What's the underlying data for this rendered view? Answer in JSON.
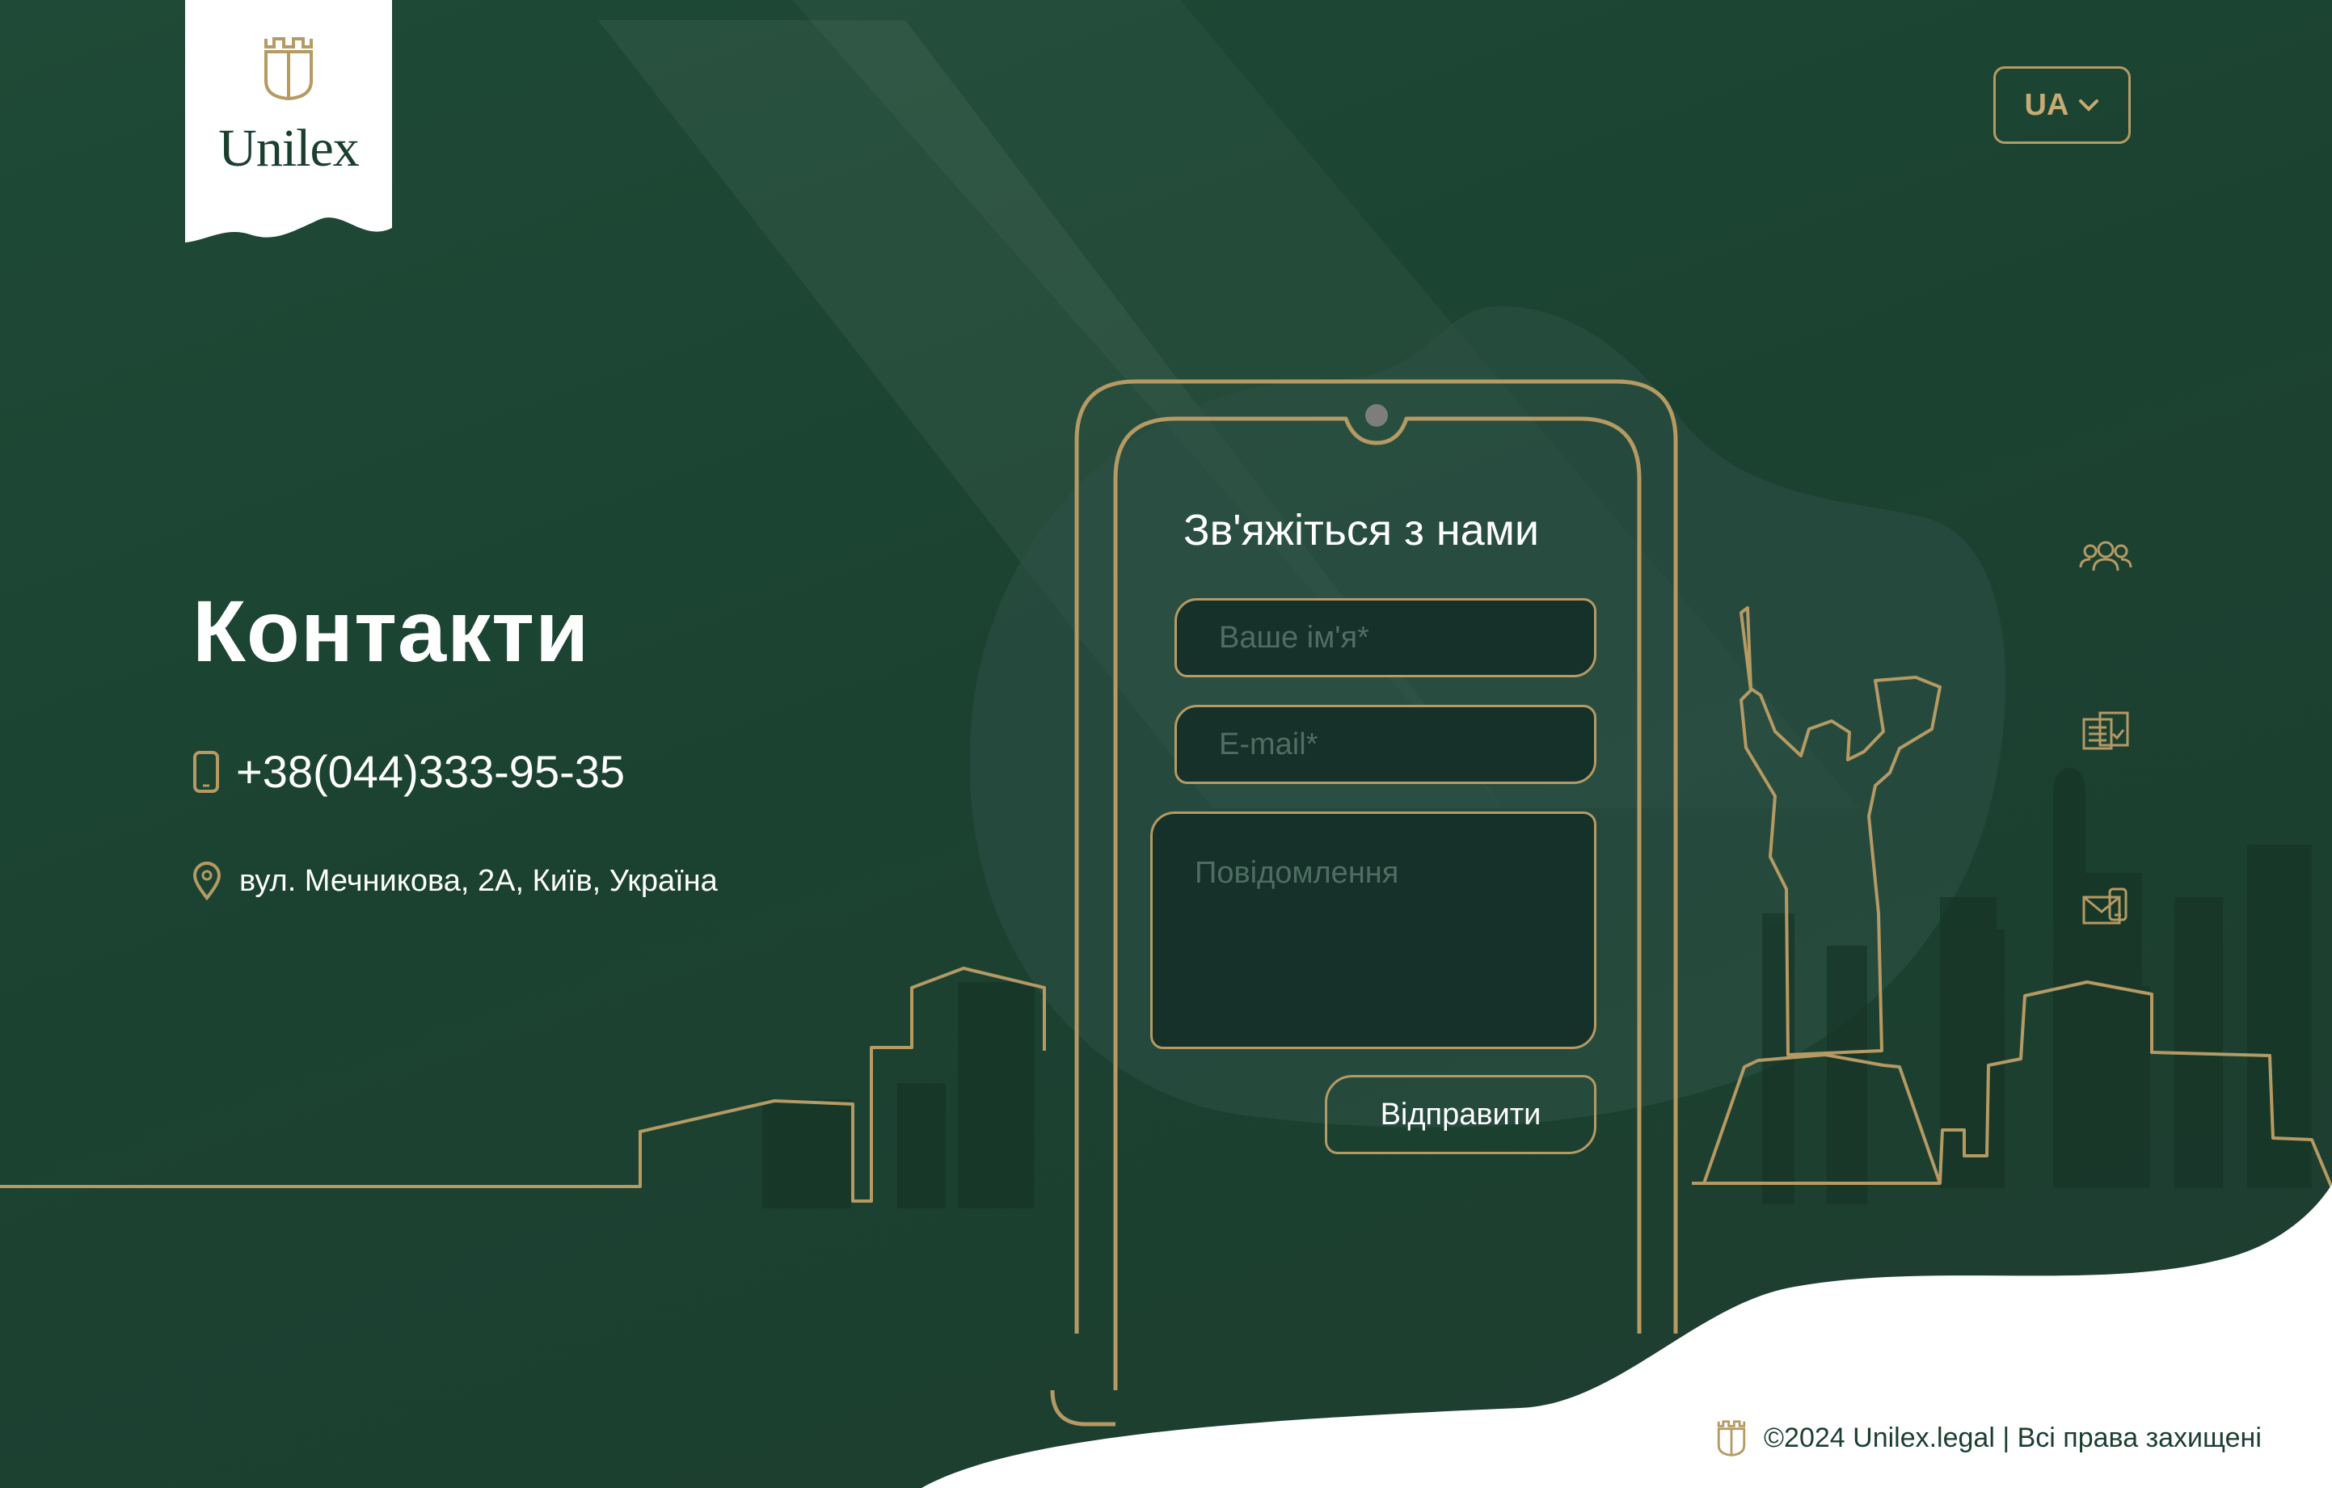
{
  "brand": {
    "name": "Unilex"
  },
  "language": {
    "current": "UA"
  },
  "contacts": {
    "title": "Контакти",
    "phone": "+38(044)333-95-35",
    "address": "вул. Мечникова, 2А, Київ, Україна"
  },
  "form": {
    "title": "Зв'яжіться з нами",
    "name_placeholder": "Ваше ім'я*",
    "email_placeholder": "E-mail*",
    "message_placeholder": "Повідомлення",
    "submit_label": "Відправити"
  },
  "side_nav": [
    {
      "icon": "team-icon"
    },
    {
      "icon": "documents-icon"
    },
    {
      "icon": "contact-mail-icon"
    }
  ],
  "footer": {
    "copyright": "©2024 Unilex.legal | Всі права захищені"
  },
  "colors": {
    "background": "#1d4433",
    "accent_gold": "#b59a63",
    "text": "#ffffff",
    "footer_bg": "#ffffff"
  }
}
